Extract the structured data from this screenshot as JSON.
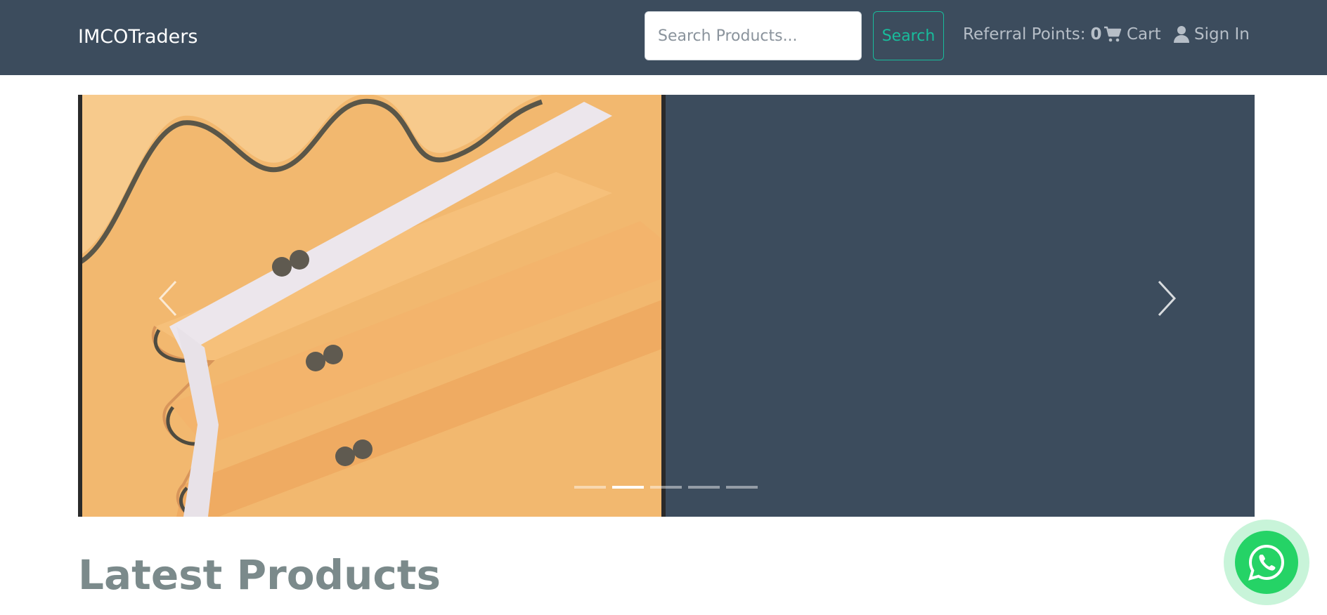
{
  "navbar": {
    "brand": "IMCOTraders",
    "search_placeholder": "Search Products...",
    "search_button": "Search",
    "referral_label": "Referral Points:",
    "referral_points": "0",
    "cart_label": "Cart",
    "signin_label": "Sign In"
  },
  "carousel": {
    "slide_count": 5,
    "active_index": 1
  },
  "main": {
    "section_title": "Latest Products"
  },
  "colors": {
    "navbar_bg": "#3c4c5d",
    "accent": "#18bc9c",
    "whatsapp": "#25d366",
    "title_gray": "#7b8a8b"
  },
  "icons": {
    "cart": "cart-icon",
    "user": "user-icon",
    "whatsapp": "whatsapp-icon",
    "prev": "chevron-left-icon",
    "next": "chevron-right-icon"
  }
}
